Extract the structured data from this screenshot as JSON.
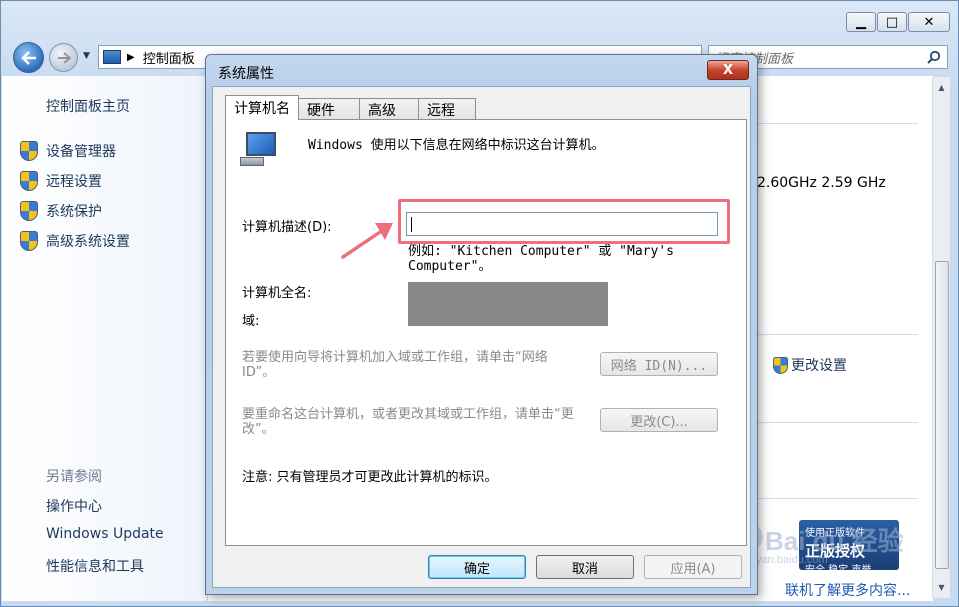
{
  "control_panel": {
    "window_buttons": {
      "minimize": "▁",
      "maximize": "□",
      "close": "✕"
    },
    "address_text": "控制面板",
    "address_overflow": "»",
    "search_placeholder": "搜索控制面板",
    "sidebar": {
      "home": "控制面板主页",
      "items": [
        {
          "label": "设备管理器",
          "icon": "shield-icon"
        },
        {
          "label": "远程设置",
          "icon": "shield-icon"
        },
        {
          "label": "系统保护",
          "icon": "shield-icon"
        },
        {
          "label": "高级系统设置",
          "icon": "shield-icon"
        }
      ],
      "see_also": "另请参阅",
      "links": [
        "操作中心",
        "Windows Update",
        "性能信息和工具"
      ]
    },
    "main": {
      "cpu_speed": "2.60GHz  2.59 GHz",
      "change_settings": "更改设置",
      "genuine_banner": {
        "top": "使用正版软件",
        "title": "正版授权",
        "bottom": "安全 稳定 声誉"
      },
      "more_link": "联机了解更多内容..."
    },
    "watermark": {
      "brand": "Bai du 经验",
      "sub": "jingyan.baidu.com"
    }
  },
  "dialog": {
    "title": "系统属性",
    "close_glyph": "X",
    "tabs": [
      "计算机名",
      "硬件",
      "高级",
      "远程"
    ],
    "active_tab": 0,
    "intro": "Windows 使用以下信息在网络中标识这台计算机。",
    "description_label": "计算机描述(D):",
    "description_value": "",
    "example_text": "例如: \"Kitchen Computer\" 或 \"Mary's Computer\"。",
    "full_name_label": "计算机全名:",
    "domain_label": "域:",
    "network_id_text": "若要使用向导将计算机加入域或工作组，请单击“网络 ID”。",
    "network_id_button": "网络 ID(N)...",
    "rename_text": "要重命名这台计算机，或者更改其域或工作组，请单击“更改”。",
    "change_button": "更改(C)...",
    "note": "注意: 只有管理员才可更改此计算机的标识。",
    "buttons": {
      "ok": "确定",
      "cancel": "取消",
      "apply": "应用(A)"
    }
  },
  "colors": {
    "highlight_box": "#ef6f7c",
    "annotation_arrow": "#ef6f7c",
    "link_blue": "#1e395b"
  }
}
